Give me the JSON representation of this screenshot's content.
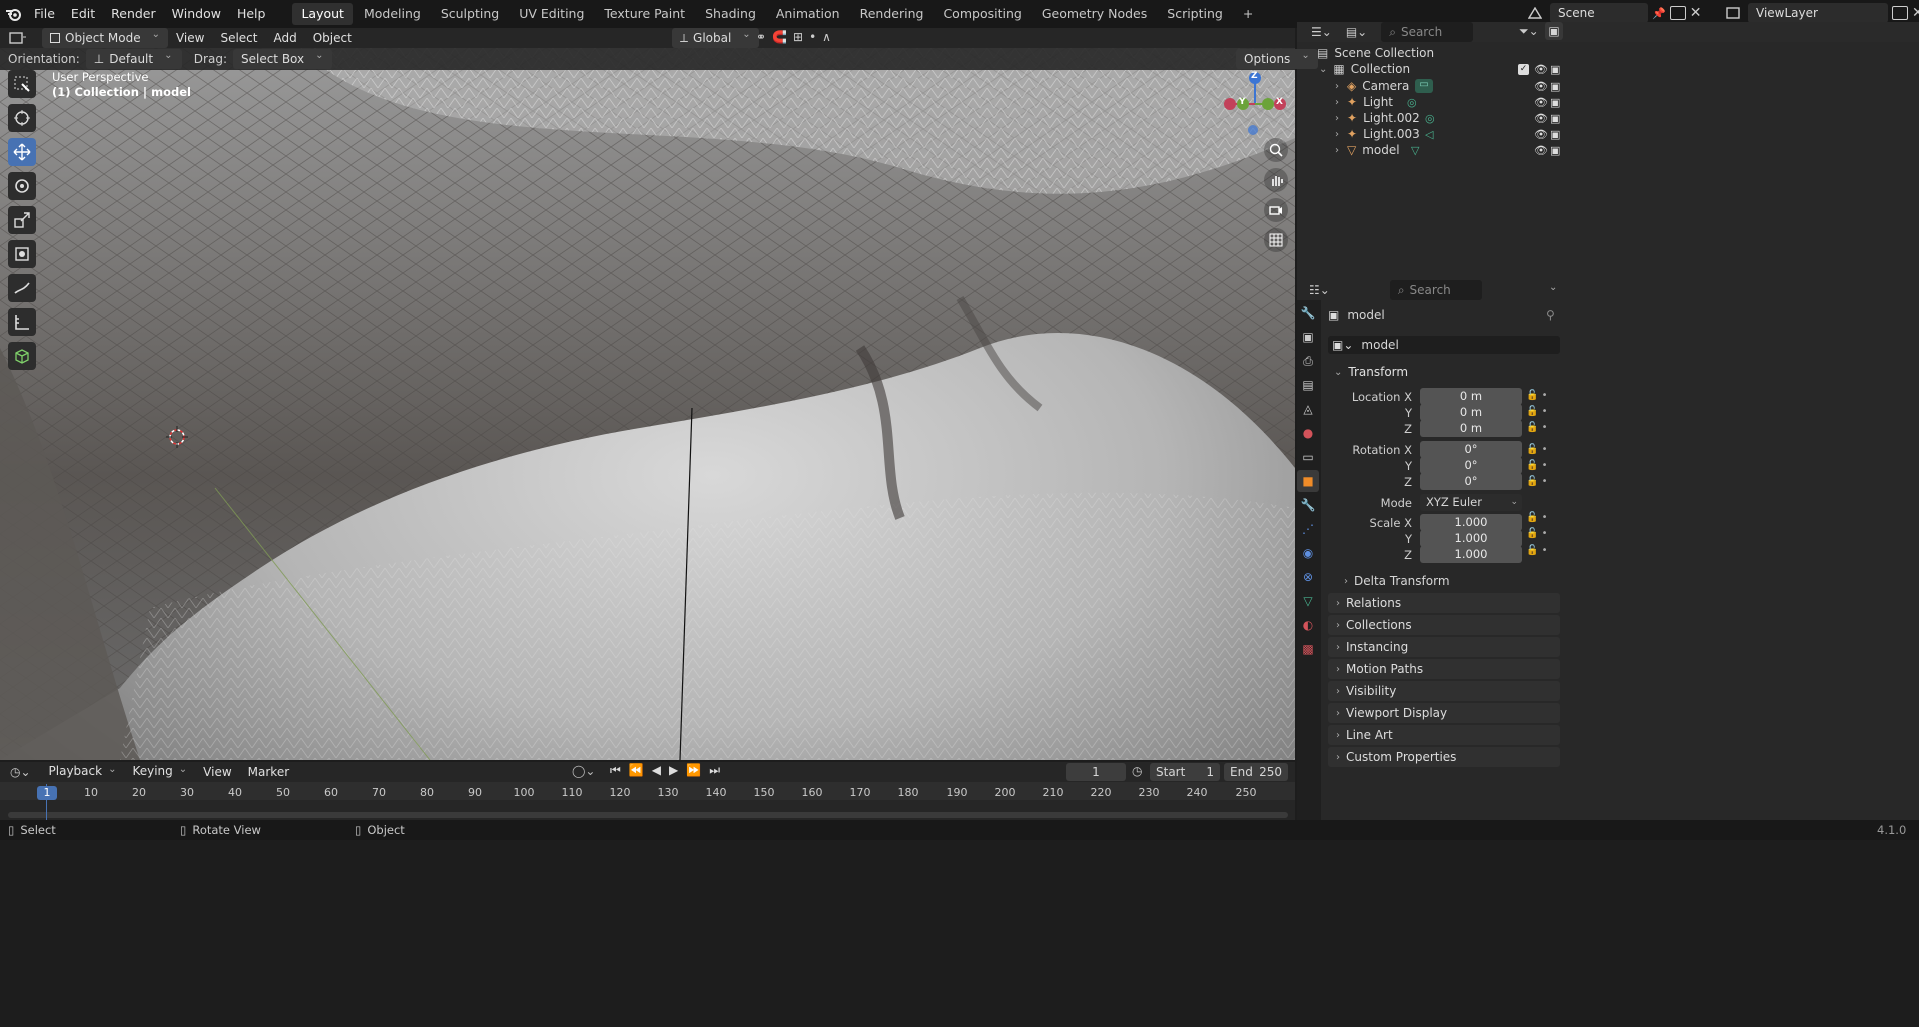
{
  "topbar": {
    "menus": [
      "File",
      "Edit",
      "Render",
      "Window",
      "Help"
    ],
    "workspaces": [
      "Layout",
      "Modeling",
      "Sculpting",
      "UV Editing",
      "Texture Paint",
      "Shading",
      "Animation",
      "Rendering",
      "Compositing",
      "Geometry Nodes",
      "Scripting"
    ],
    "active_workspace": "Layout",
    "add_tab": "+",
    "scene": "Scene",
    "view_layer": "ViewLayer"
  },
  "viewport_header": {
    "mode": "Object Mode",
    "menus": [
      "View",
      "Select",
      "Add",
      "Object"
    ],
    "transform_orientation": "Global",
    "orientation_label": "Orientation:",
    "orientation_value": "Default",
    "drag_label": "Drag:",
    "drag_value": "Select Box",
    "options": "Options"
  },
  "viewport": {
    "overlay_line1": "User Perspective",
    "overlay_line2": "(1) Collection | model",
    "gizmo": {
      "z": "Z",
      "y": "Y",
      "x": "X"
    },
    "tools": [
      "select-box",
      "cursor",
      "move",
      "rotate",
      "scale",
      "transform",
      "annotate",
      "measure",
      "add-cube"
    ],
    "active_tool": "move"
  },
  "outliner": {
    "search_placeholder": "Search",
    "root": "Scene Collection",
    "collection": "Collection",
    "items": [
      {
        "name": "Camera",
        "icon": "camera-icon"
      },
      {
        "name": "Light",
        "icon": "light-icon"
      },
      {
        "name": "Light.002",
        "icon": "light-icon"
      },
      {
        "name": "Light.003",
        "icon": "light-icon"
      },
      {
        "name": "model",
        "icon": "mesh-icon"
      }
    ]
  },
  "properties": {
    "search_placeholder": "Search",
    "object_name": "model",
    "datablock_name": "model",
    "transform_title": "Transform",
    "location": {
      "label": "Location X",
      "x": "0 m",
      "y": "0 m",
      "z": "0 m"
    },
    "rotation": {
      "label": "Rotation X",
      "x": "0°",
      "y": "0°",
      "z": "0°"
    },
    "mode_label": "Mode",
    "mode_value": "XYZ Euler",
    "scale": {
      "label": "Scale X",
      "x": "1.000",
      "y": "1.000",
      "z": "1.000"
    },
    "axis_y": "Y",
    "axis_z": "Z",
    "delta_transform": "Delta Transform",
    "panels": [
      "Relations",
      "Collections",
      "Instancing",
      "Motion Paths",
      "Visibility",
      "Viewport Display",
      "Line Art",
      "Custom Properties"
    ]
  },
  "timeline": {
    "menus": [
      "Playback",
      "Keying",
      "View",
      "Marker"
    ],
    "current_frame": "1",
    "start_label": "Start",
    "start": "1",
    "end_label": "End",
    "end": "250",
    "ruler": [
      "1",
      "10",
      "20",
      "30",
      "40",
      "50",
      "60",
      "70",
      "80",
      "90",
      "100",
      "110",
      "120",
      "130",
      "140",
      "150",
      "160",
      "170",
      "180",
      "190",
      "200",
      "210",
      "220",
      "230",
      "240",
      "250"
    ]
  },
  "statusbar": {
    "select": "Select",
    "rotate_view": "Rotate View",
    "object": "Object",
    "version": "4.1.0"
  },
  "colors": {
    "accent": "#4772b3",
    "x_axis": "#c2415a",
    "y_axis": "#6ba33a",
    "z_axis": "#3b75d4"
  }
}
